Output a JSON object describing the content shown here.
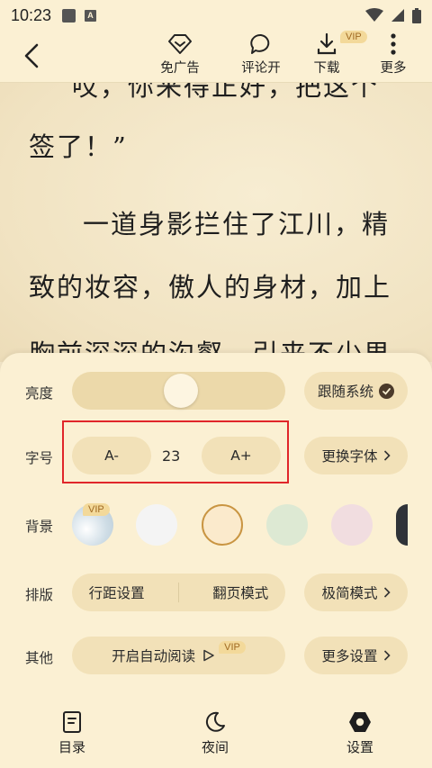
{
  "status_bar": {
    "time": "10:23"
  },
  "toolbar": {
    "no_ads": "免广告",
    "comments": "评论开",
    "download": "下载",
    "download_badge": "VIP",
    "more": "更多"
  },
  "content": {
    "line1": "哎，你来得正好，把这个",
    "line2": "签了！”",
    "line3": "一道身影拦住了江川，精",
    "line4": "致的妆容，傲人的身材，加上",
    "line5": "胸前深深的沟壑，引来不少男"
  },
  "settings": {
    "brightness": {
      "label": "亮度",
      "value": 0.45,
      "follow_system": "跟随系统"
    },
    "font_size": {
      "label": "字号",
      "decrease": "A-",
      "value": "23",
      "increase": "A+",
      "change_font": "更换字体"
    },
    "background": {
      "label": "背景",
      "vip_badge": "VIP",
      "swatches": [
        {
          "name": "sky",
          "color": "#dde8ee",
          "vip": true
        },
        {
          "name": "white",
          "color": "#f4f4f4"
        },
        {
          "name": "yellow",
          "color": "#fbeacc",
          "selected": true
        },
        {
          "name": "green",
          "color": "#dde9d3"
        },
        {
          "name": "pink",
          "color": "#f1dde0"
        },
        {
          "name": "dark",
          "color": "#2f3338"
        }
      ]
    },
    "layout": {
      "label": "排版",
      "line_spacing": "行距设置",
      "page_turn": "翻页模式",
      "minimal_mode": "极简模式"
    },
    "other": {
      "label": "其他",
      "auto_read": "开启自动阅读",
      "auto_read_badge": "VIP",
      "more_settings": "更多设置"
    }
  },
  "bottom_nav": {
    "toc": "目录",
    "night": "夜间",
    "settings": "设置"
  }
}
